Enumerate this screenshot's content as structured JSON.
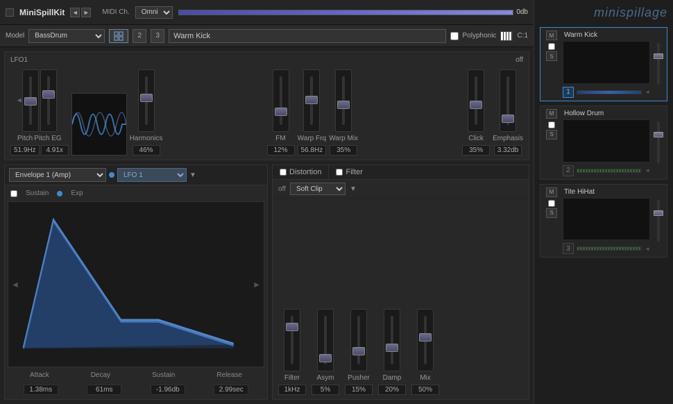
{
  "app": {
    "title": "MiniSpillKit",
    "brand": "minispillage"
  },
  "titlebar": {
    "name": "MiniSpillKit",
    "midi_label": "MIDI Ch.",
    "midi_value": "Omni",
    "volume_value": "0db"
  },
  "toolbar": {
    "model_label": "Model",
    "model_value": "BassDrum",
    "button_2": "2",
    "button_3": "3",
    "preset_name": "Warm Kick",
    "poly_label": "Polyphonic",
    "ch_label": "C:1"
  },
  "lfo": {
    "title": "LFO1",
    "status": "off",
    "pitch_label": "Pitch",
    "pitch_value": "51.9Hz",
    "pitch_eg_label": "Pitch EG",
    "pitch_eg_value": "4.91x",
    "harmonics_label": "Harmonics",
    "harmonics_value": "46%",
    "fm_label": "FM",
    "fm_value": "12%",
    "warp_frq_label": "Warp Frq",
    "warp_frq_value": "56.8Hz",
    "warp_mix_label": "Warp Mix",
    "warp_mix_value": "35%",
    "click_label": "Click",
    "click_value": "35%",
    "emphasis_label": "Emphasis",
    "emphasis_value": "3.32db"
  },
  "envelope": {
    "title": "Envelope 1 (Amp)",
    "lfo_label": "LFO 1",
    "sustain_label": "Sustain",
    "exp_label": "Exp",
    "attack_label": "Attack",
    "attack_value": "1.38ms",
    "decay_label": "Decay",
    "decay_value": "61ms",
    "sustain_value": "-1.96db",
    "release_label": "Release",
    "release_value": "2.99sec"
  },
  "distortion": {
    "title": "Distortion",
    "enabled": false,
    "off_label": "off",
    "type": "Soft Clip",
    "filter_label": "Filter",
    "filter_enabled": false,
    "filter_label2": "Filter",
    "filter_value": "1kHz",
    "asym_label": "Asym",
    "asym_value": "5%",
    "pusher_label": "Pusher",
    "pusher_value": "15%",
    "damp_label": "Damp",
    "damp_value": "20%",
    "mix_label": "Mix",
    "mix_value": "50%"
  },
  "channels": [
    {
      "name": "Warm Kick",
      "num": "1",
      "active": true,
      "m": "M",
      "s": "S"
    },
    {
      "name": "Hollow Drum",
      "num": "2",
      "active": false,
      "m": "M",
      "s": "S"
    },
    {
      "name": "Tite HiHat",
      "num": "3",
      "active": false,
      "m": "M",
      "s": "S"
    }
  ]
}
